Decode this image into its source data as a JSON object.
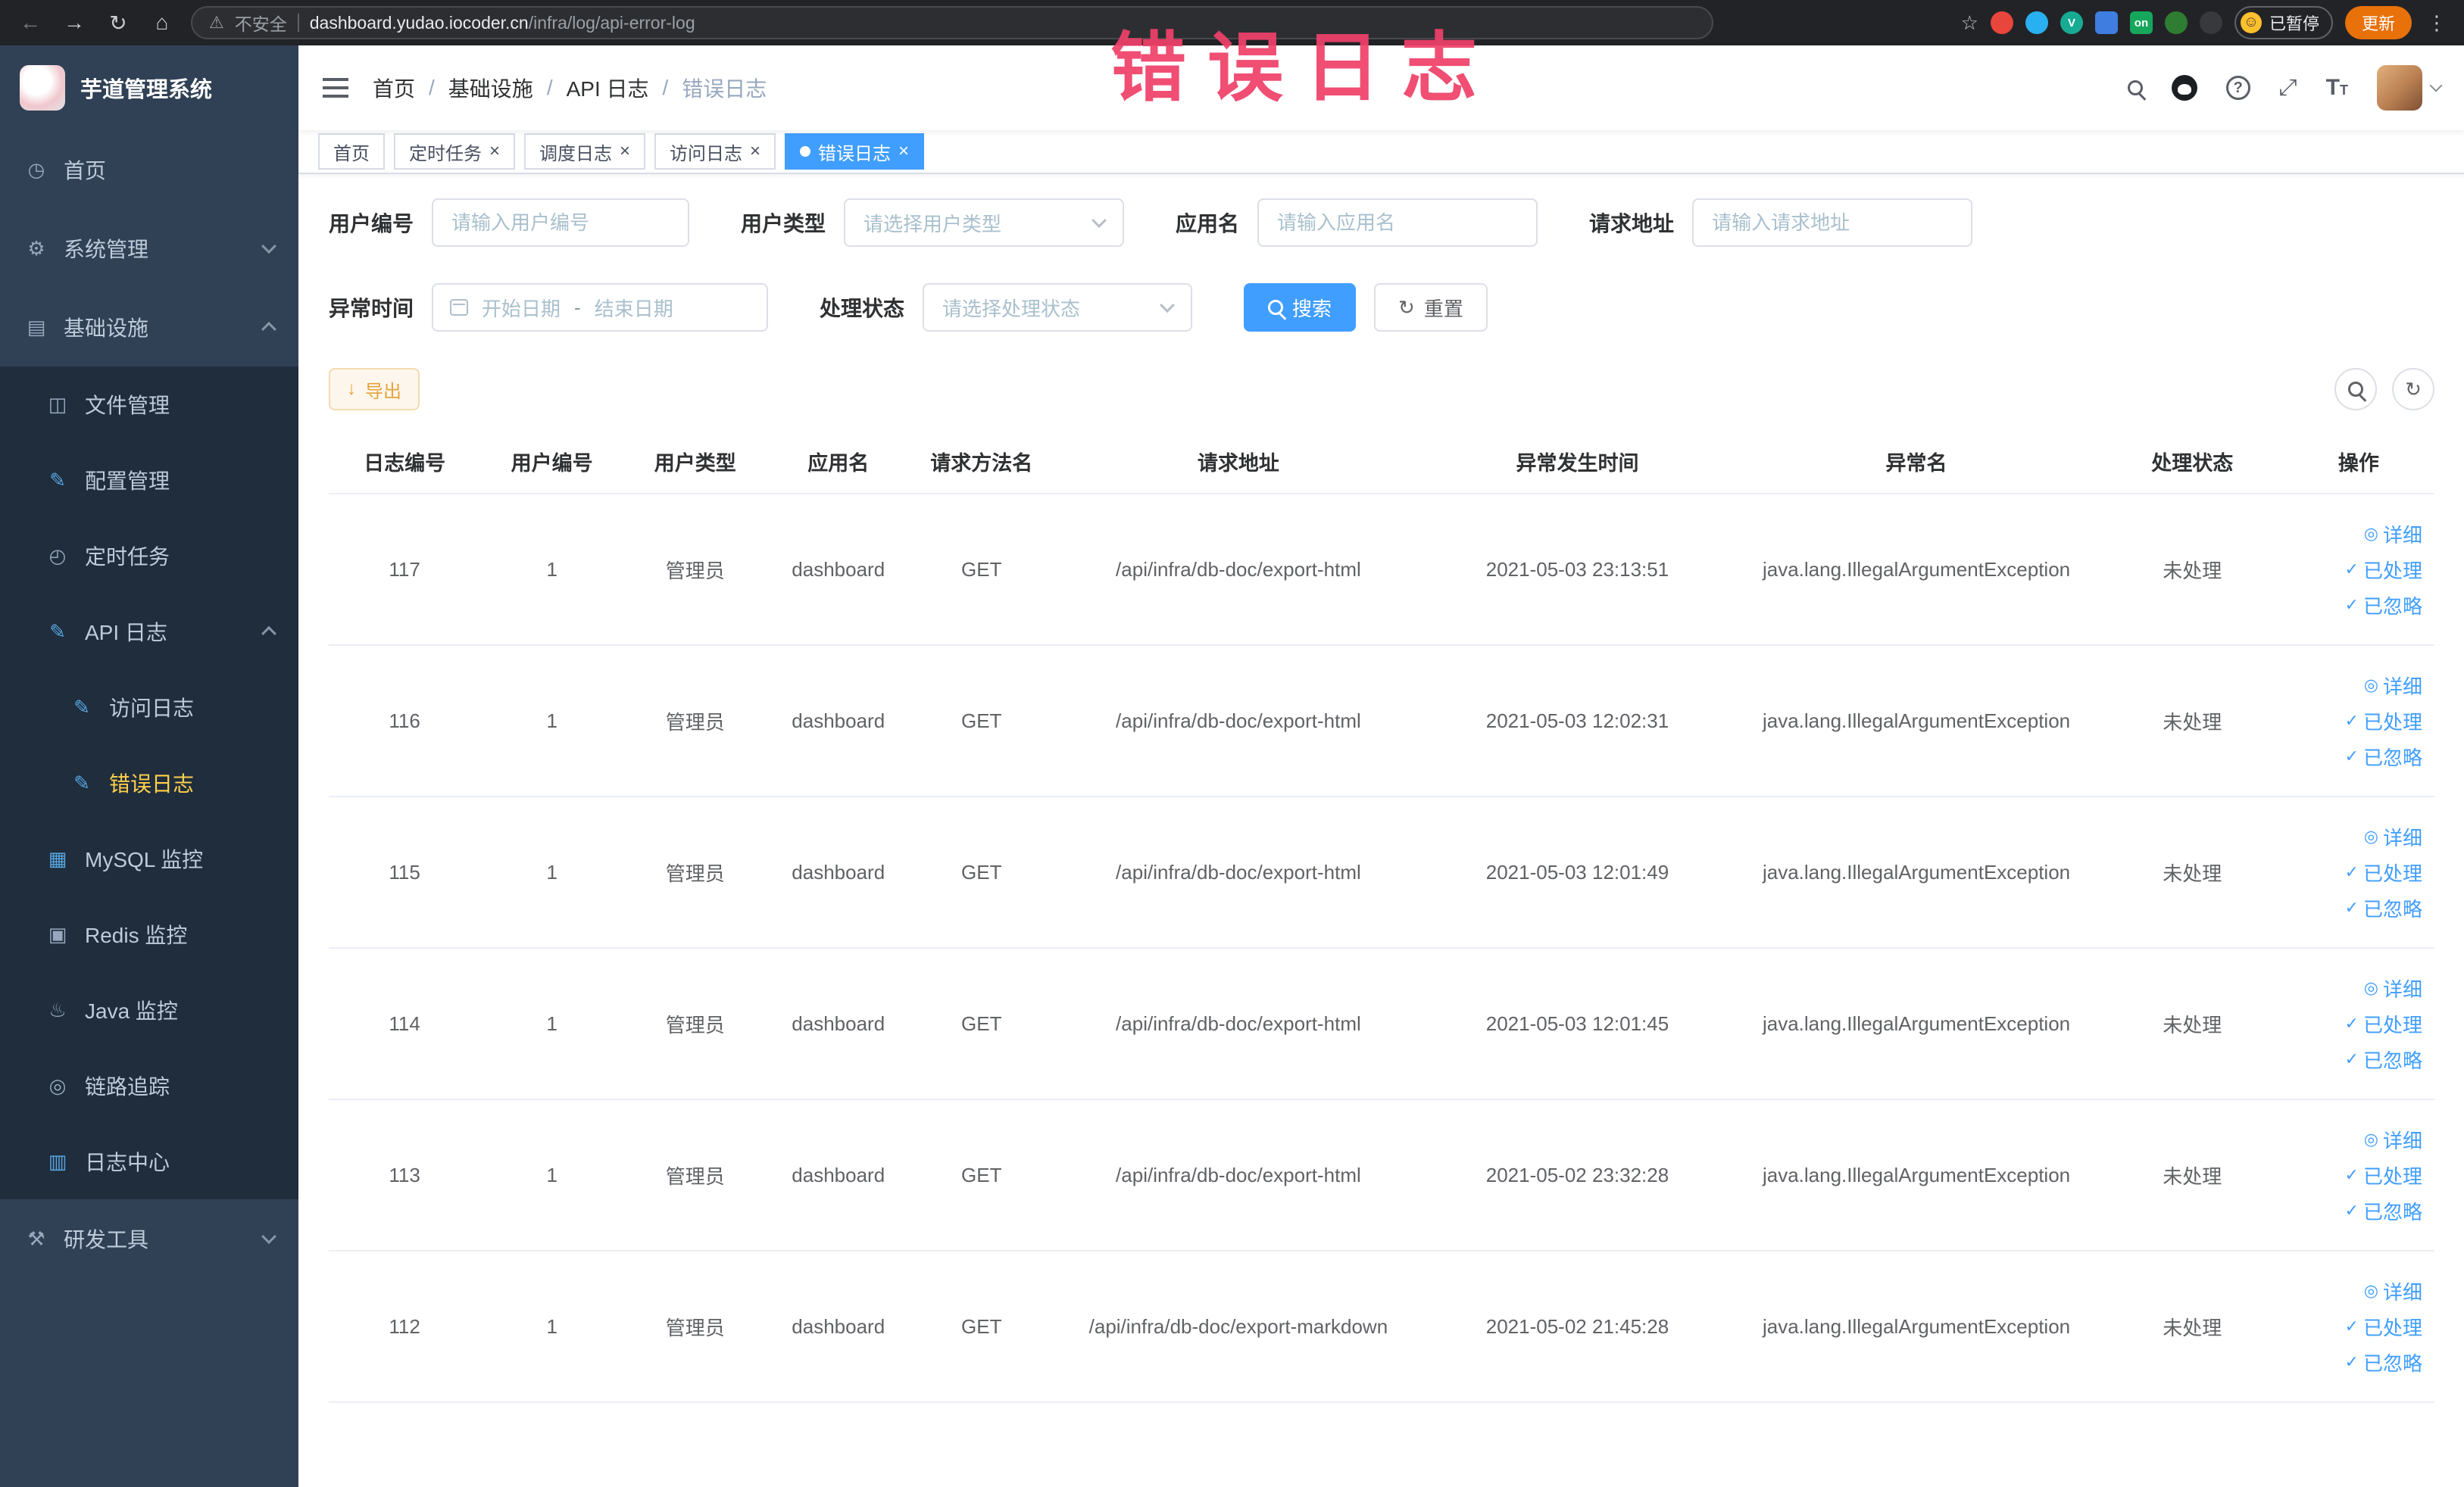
{
  "overlay": {
    "title": "错误日志"
  },
  "browser": {
    "security_label": "不安全",
    "url_host": "dashboard.yudao.iocoder.cn",
    "url_path": "/infra/log/api-error-log",
    "paused_label": "已暂停",
    "update_label": "更新",
    "extensions": [
      {
        "name": "red-circle-extension-icon",
        "bg": "#e8453c",
        "label": "",
        "shape": ""
      },
      {
        "name": "blue-drop-extension-icon",
        "bg": "#29b0f0",
        "label": "",
        "shape": ""
      },
      {
        "name": "green-v-extension-icon",
        "bg": "#17ab93",
        "label": "V",
        "shape": ""
      },
      {
        "name": "blue-grid-extension-icon",
        "bg": "#3f7de0",
        "label": "",
        "shape": "square"
      },
      {
        "name": "on-badge-extension-icon",
        "bg": "#16a75c",
        "label": "on",
        "shape": "square"
      },
      {
        "name": "green-leaf-extension-icon",
        "bg": "#2e7d32",
        "label": "",
        "shape": ""
      },
      {
        "name": "paw-extension-icon",
        "bg": "#37393c",
        "label": "",
        "shape": ""
      }
    ]
  },
  "sidebar": {
    "logo_title": "芋道管理系统",
    "items": [
      {
        "label": "首页",
        "glyph": "◷",
        "cls": "d0",
        "chevron": "",
        "icls": ""
      },
      {
        "label": "系统管理",
        "glyph": "⚙",
        "cls": "d0",
        "chevron": "down",
        "icls": ""
      },
      {
        "label": "基础设施",
        "glyph": "▤",
        "cls": "d0",
        "chevron": "up",
        "icls": ""
      },
      {
        "label": "文件管理",
        "glyph": "◫",
        "cls": "d1",
        "chevron": "",
        "icls": ""
      },
      {
        "label": "配置管理",
        "glyph": "✎",
        "cls": "d1",
        "chevron": "",
        "icls": "blue"
      },
      {
        "label": "定时任务",
        "glyph": "◴",
        "cls": "d1",
        "chevron": "",
        "icls": ""
      },
      {
        "label": "API 日志",
        "glyph": "✎",
        "cls": "d1",
        "chevron": "up",
        "icls": "blue"
      },
      {
        "label": "访问日志",
        "glyph": "✎",
        "cls": "d2",
        "chevron": "",
        "icls": "blue"
      },
      {
        "label": "错误日志",
        "glyph": "✎",
        "cls": "d2 active",
        "chevron": "",
        "icls": "blue"
      },
      {
        "label": "MySQL 监控",
        "glyph": "▦",
        "cls": "d1",
        "chevron": "",
        "icls": "blue"
      },
      {
        "label": "Redis 监控",
        "glyph": "▣",
        "cls": "d1",
        "chevron": "",
        "icls": ""
      },
      {
        "label": "Java 监控",
        "glyph": "♨",
        "cls": "d1",
        "chevron": "",
        "icls": ""
      },
      {
        "label": "链路追踪",
        "glyph": "◎",
        "cls": "d1",
        "chevron": "",
        "icls": ""
      },
      {
        "label": "日志中心",
        "glyph": "▥",
        "cls": "d1",
        "chevron": "",
        "icls": "blue"
      },
      {
        "label": "研发工具",
        "glyph": "⚒",
        "cls": "d0",
        "chevron": "down",
        "icls": ""
      }
    ]
  },
  "header": {
    "breadcrumbs": [
      "首页",
      "基础设施",
      "API 日志",
      "错误日志"
    ],
    "separator": "/"
  },
  "tabs": [
    {
      "label": "首页",
      "closable": false,
      "active": false,
      "cls": ""
    },
    {
      "label": "定时任务",
      "closable": true,
      "active": false,
      "cls": ""
    },
    {
      "label": "调度日志",
      "closable": true,
      "active": false,
      "cls": ""
    },
    {
      "label": "访问日志",
      "closable": true,
      "active": false,
      "cls": ""
    },
    {
      "label": "错误日志",
      "closable": true,
      "active": true,
      "cls": "active"
    }
  ],
  "filters": {
    "user_id": {
      "label": "用户编号",
      "placeholder": "请输入用户编号"
    },
    "user_type": {
      "label": "用户类型",
      "placeholder": "请选择用户类型"
    },
    "app_name": {
      "label": "应用名",
      "placeholder": "请输入应用名"
    },
    "request_url": {
      "label": "请求地址",
      "placeholder": "请输入请求地址"
    },
    "exception_time": {
      "label": "异常时间",
      "start_placeholder": "开始日期",
      "separator": "-",
      "end_placeholder": "结束日期"
    },
    "process_status": {
      "label": "处理状态",
      "placeholder": "请选择处理状态"
    },
    "search_label": "搜索",
    "reset_label": "重置"
  },
  "toolbar": {
    "export_label": "导出"
  },
  "table": {
    "columns": [
      "日志编号",
      "用户编号",
      "用户类型",
      "应用名",
      "请求方法名",
      "请求地址",
      "异常发生时间",
      "异常名",
      "处理状态",
      "操作"
    ],
    "rows": [
      {
        "id": "117",
        "user_id": "1",
        "user_type": "管理员",
        "app": "dashboard",
        "method": "GET",
        "url": "/api/infra/db-doc/export-html",
        "time": "2021-05-03 23:13:51",
        "exception": "java.lang.IllegalArgumentException",
        "status": "未处理",
        "actions": [
          "详细",
          "已处理",
          "已忽略"
        ]
      },
      {
        "id": "116",
        "user_id": "1",
        "user_type": "管理员",
        "app": "dashboard",
        "method": "GET",
        "url": "/api/infra/db-doc/export-html",
        "time": "2021-05-03 12:02:31",
        "exception": "java.lang.IllegalArgumentException",
        "status": "未处理",
        "actions": [
          "详细",
          "已处理",
          "已忽略"
        ]
      },
      {
        "id": "115",
        "user_id": "1",
        "user_type": "管理员",
        "app": "dashboard",
        "method": "GET",
        "url": "/api/infra/db-doc/export-html",
        "time": "2021-05-03 12:01:49",
        "exception": "java.lang.IllegalArgumentException",
        "status": "未处理",
        "actions": [
          "详细",
          "已处理",
          "已忽略"
        ]
      },
      {
        "id": "114",
        "user_id": "1",
        "user_type": "管理员",
        "app": "dashboard",
        "method": "GET",
        "url": "/api/infra/db-doc/export-html",
        "time": "2021-05-03 12:01:45",
        "exception": "java.lang.IllegalArgumentException",
        "status": "未处理",
        "actions": [
          "详细",
          "已处理",
          "已忽略"
        ]
      },
      {
        "id": "113",
        "user_id": "1",
        "user_type": "管理员",
        "app": "dashboard",
        "method": "GET",
        "url": "/api/infra/db-doc/export-html",
        "time": "2021-05-02 23:32:28",
        "exception": "java.lang.IllegalArgumentException",
        "status": "未处理",
        "actions": [
          "详细",
          "已处理",
          "已忽略"
        ]
      },
      {
        "id": "112",
        "user_id": "1",
        "user_type": "管理员",
        "app": "dashboard",
        "method": "GET",
        "url": "/api/infra/db-doc/export-markdown",
        "time": "2021-05-02 21:45:28",
        "exception": "java.lang.IllegalArgumentException",
        "status": "未处理",
        "actions": [
          "详细",
          "已处理",
          "已忽略"
        ]
      }
    ]
  }
}
